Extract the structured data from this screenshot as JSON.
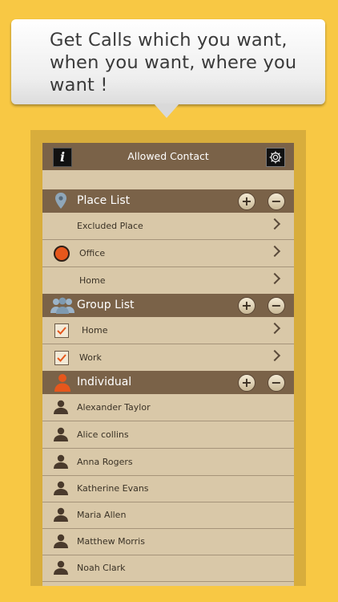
{
  "promo": {
    "line1": "Get Calls which you want,",
    "line2": "when you want, where you",
    "line3": "want !"
  },
  "topbar": {
    "title": "Allowed Contact",
    "info_label": "i"
  },
  "place_list": {
    "title": "Place List",
    "add": "+",
    "remove": "−",
    "items": [
      {
        "label": "Excluded Place"
      },
      {
        "label": "Office"
      },
      {
        "label": "Home"
      }
    ]
  },
  "group_list": {
    "title": "Group List",
    "add": "+",
    "remove": "−",
    "items": [
      {
        "label": "Home"
      },
      {
        "label": "Work"
      }
    ]
  },
  "individual": {
    "title": "Individual",
    "add": "+",
    "remove": "−",
    "items": [
      {
        "label": "Alexander Taylor"
      },
      {
        "label": "Alice collins"
      },
      {
        "label": "Anna Rogers"
      },
      {
        "label": "Katherine Evans"
      },
      {
        "label": "Maria Allen"
      },
      {
        "label": "Matthew Morris"
      },
      {
        "label": "Noah Clark"
      }
    ]
  },
  "colors": {
    "background": "#f8c844",
    "bar": "#7a6248",
    "list_bg": "#d9c8a8",
    "accent_orange": "#e6571c"
  }
}
